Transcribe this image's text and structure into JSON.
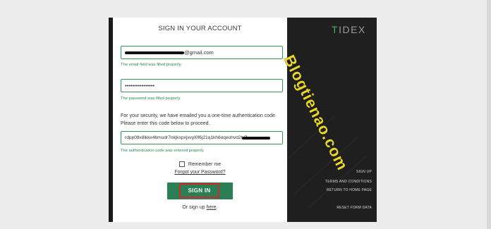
{
  "form": {
    "title": "SIGN IN YOUR ACCOUNT",
    "email_domain": "@gmail.com",
    "email_hint": "The email field was filled properly.",
    "password_value": "••••••••••••••••",
    "password_hint": "The password was filled properly.",
    "security_line1": "For your security, we have emailed you a one-time authentication code.",
    "security_line2": "Please enter this code below to proceed.",
    "auth_code_value": "rdpp08x8lkkx4bmudr7nkjkxpxjxvyl0f6j21q1kh6oqeuhvd2tvZ",
    "auth_hint": "The authentication code was entered properly.",
    "remember_label": "Remember me",
    "forgot_label": "Forgot your Password?",
    "signin_label": "SIGN IN",
    "signup_prefix": "Or sign up",
    "signup_link": "here",
    "signup_suffix": "."
  },
  "side": {
    "brand_t": "T",
    "brand_rest": "IDEX",
    "links": [
      "SIGN UP",
      "TERMS AND CONDITIONS",
      "RETURN TO HOME PAGE",
      "RESET FORM DATA"
    ]
  },
  "watermark": "Blogtienao.com",
  "colors": {
    "accent_green": "#2b7f55",
    "hint_green": "#2e8a4e",
    "highlight_red": "#d12a2a",
    "watermark_yellow": "#e8d62a",
    "panel_dark": "#1f1f1f"
  }
}
